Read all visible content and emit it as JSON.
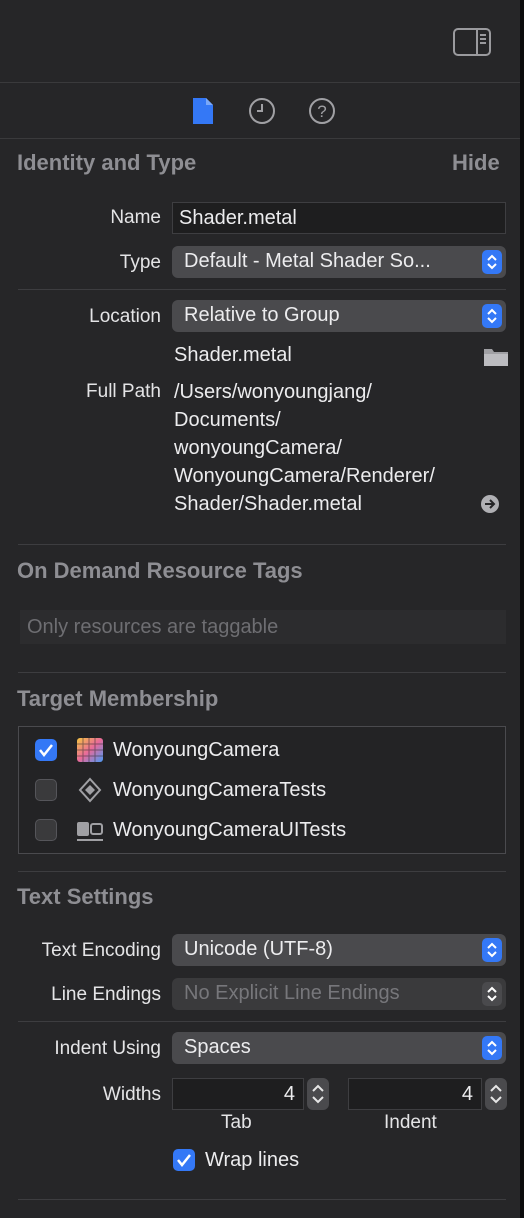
{
  "toolbar": {
    "inspector_toggle_icon": "sidebar-right-icon"
  },
  "inspector_tabs": [
    {
      "name": "file-inspector",
      "icon": "document-icon",
      "active": true
    },
    {
      "name": "history-inspector",
      "icon": "clock-icon",
      "active": false
    },
    {
      "name": "quick-help-inspector",
      "icon": "question-icon",
      "active": false
    }
  ],
  "identity": {
    "title": "Identity and Type",
    "hide_label": "Hide",
    "name_label": "Name",
    "name_value": "Shader.metal",
    "type_label": "Type",
    "type_value": "Default - Metal Shader So...",
    "location_label": "Location",
    "location_value": "Relative to Group",
    "file_name": "Shader.metal",
    "full_path_label": "Full Path",
    "full_path_lines": [
      "/Users/wonyoungjang/",
      "Documents/",
      "wonyoungCamera/",
      "WonyoungCamera/Renderer/",
      "Shader/Shader.metal"
    ]
  },
  "on_demand": {
    "title": "On Demand Resource Tags",
    "placeholder": "Only resources are taggable"
  },
  "membership": {
    "title": "Target Membership",
    "targets": [
      {
        "name": "WonyoungCamera",
        "checked": true,
        "icon": "app-target-icon"
      },
      {
        "name": "WonyoungCameraTests",
        "checked": false,
        "icon": "test-target-icon"
      },
      {
        "name": "WonyoungCameraUITests",
        "checked": false,
        "icon": "ui-test-target-icon"
      }
    ]
  },
  "text_settings": {
    "title": "Text Settings",
    "encoding_label": "Text Encoding",
    "encoding_value": "Unicode (UTF-8)",
    "line_endings_label": "Line Endings",
    "line_endings_value": "No Explicit Line Endings",
    "indent_using_label": "Indent Using",
    "indent_using_value": "Spaces",
    "widths_label": "Widths",
    "tab_width": "4",
    "indent_width": "4",
    "tab_caption": "Tab",
    "indent_caption": "Indent",
    "wrap_label": "Wrap lines",
    "wrap_checked": true
  },
  "colors": {
    "accent": "#3478f6",
    "background": "#262628",
    "section_title": "#8e8e93"
  }
}
